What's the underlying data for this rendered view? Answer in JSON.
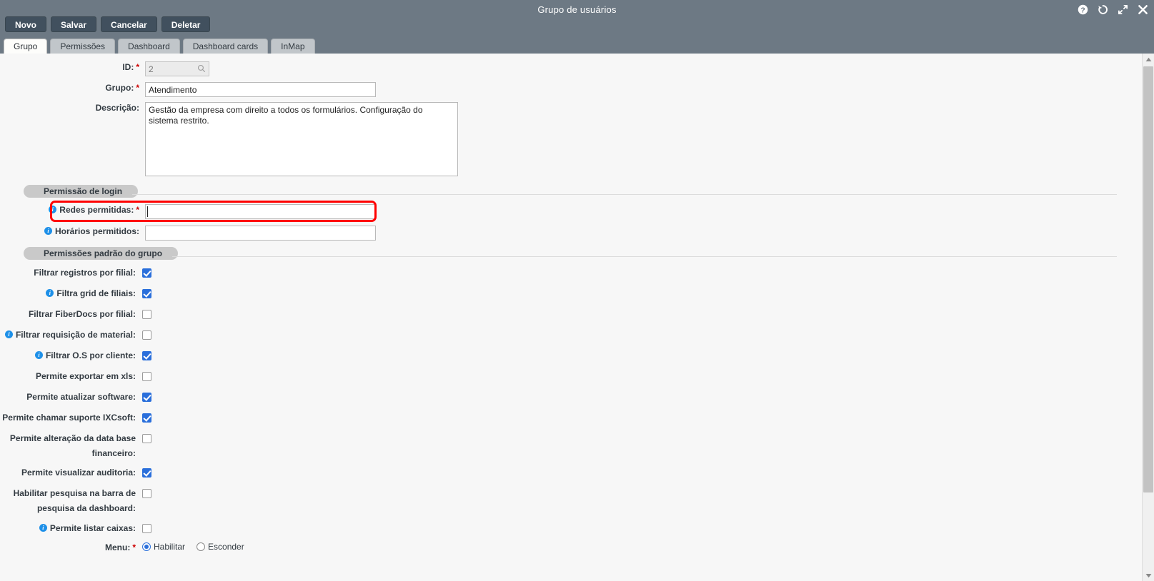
{
  "window": {
    "title": "Grupo de usuários",
    "title_icons": [
      {
        "name": "help-icon",
        "glyph": "?"
      },
      {
        "name": "history-icon",
        "glyph": "history"
      },
      {
        "name": "maximize-icon",
        "glyph": "expand"
      },
      {
        "name": "close-icon",
        "glyph": "close"
      }
    ]
  },
  "toolbar": {
    "buttons": [
      {
        "label": "Novo",
        "name": "novo-button"
      },
      {
        "label": "Salvar",
        "name": "salvar-button"
      },
      {
        "label": "Cancelar",
        "name": "cancelar-button"
      },
      {
        "label": "Deletar",
        "name": "deletar-button"
      }
    ]
  },
  "tabs": [
    {
      "label": "Grupo",
      "active": true
    },
    {
      "label": "Permissões",
      "active": false
    },
    {
      "label": "Dashboard",
      "active": false
    },
    {
      "label": "Dashboard cards",
      "active": false
    },
    {
      "label": "InMap",
      "active": false
    }
  ],
  "form": {
    "id": {
      "label": "ID:",
      "required": true,
      "value": "2",
      "placeholder": "",
      "disabled": true,
      "icon": "search-icon"
    },
    "grupo": {
      "label": "Grupo:",
      "required": true,
      "value": "Atendimento",
      "placeholder": ""
    },
    "descricao": {
      "label": "Descrição:",
      "required": false,
      "value": "Gestão da empresa com direito a todos os formulários. Configuração do sistema restrito.",
      "placeholder": ""
    }
  },
  "sections": {
    "login": {
      "title": "Permissão de login",
      "fields": [
        {
          "label": "Redes permitidas:",
          "required": true,
          "info": true,
          "value": "",
          "placeholder": "",
          "highlighted": true,
          "focused": true
        },
        {
          "label": "Horários permitidos:",
          "required": false,
          "info": true,
          "value": "",
          "placeholder": "",
          "highlighted": false,
          "focused": false
        }
      ]
    },
    "permissoes": {
      "title": "Permissões padrão do grupo",
      "checkboxes": [
        {
          "label": "Filtrar registros por filial:",
          "info": false,
          "checked": true
        },
        {
          "label": "Filtra grid de filiais:",
          "info": true,
          "checked": true
        },
        {
          "label": "Filtrar FiberDocs por filial:",
          "info": false,
          "checked": false
        },
        {
          "label": "Filtrar requisição de material:",
          "info": true,
          "checked": false
        },
        {
          "label": "Filtrar O.S por cliente:",
          "info": true,
          "checked": true
        },
        {
          "label": "Permite exportar em xls:",
          "info": false,
          "checked": false
        },
        {
          "label": "Permite atualizar software:",
          "info": false,
          "checked": true
        },
        {
          "label": "Permite chamar suporte IXCsoft:",
          "info": false,
          "checked": true
        },
        {
          "label": "Permite alteração da data base financeiro:",
          "info": false,
          "checked": false
        },
        {
          "label": "Permite visualizar auditoria:",
          "info": false,
          "checked": true
        },
        {
          "label": "Habilitar pesquisa na barra de pesquisa da dashboard:",
          "info": false,
          "checked": false
        },
        {
          "label": "Permite listar caixas:",
          "info": true,
          "checked": false
        }
      ],
      "menu": {
        "label": "Menu:",
        "required": true,
        "options": [
          {
            "label": "Habilitar",
            "selected": true
          },
          {
            "label": "Esconder",
            "selected": false
          }
        ]
      }
    }
  },
  "colors": {
    "titlebar": "#6d7984",
    "button": "#41505e",
    "accent_checkbox": "#2a6fdb",
    "info_icon": "#1e90e8",
    "required_asterisk": "#cc0000",
    "highlight": "#ff0000",
    "panel": "#f7f7f7",
    "section_pill": "#c9c9c9"
  }
}
